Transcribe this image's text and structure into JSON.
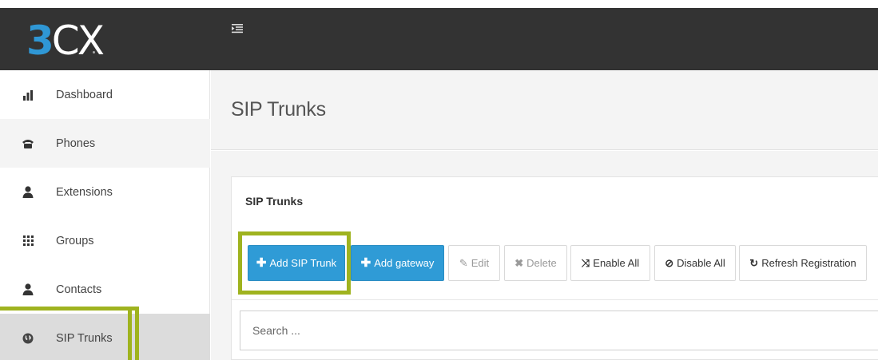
{
  "brand": {
    "logo_number": "3",
    "logo_letters": "CX",
    "accent_color": "#2f97d5"
  },
  "topbar": {
    "menu_toggle_icon": "menu-toggle-icon"
  },
  "sidebar": {
    "items": [
      {
        "label": "Dashboard",
        "icon": "bar-chart-icon"
      },
      {
        "label": "Phones",
        "icon": "phone-icon"
      },
      {
        "label": "Extensions",
        "icon": "user-icon"
      },
      {
        "label": "Groups",
        "icon": "grid-icon"
      },
      {
        "label": "Contacts",
        "icon": "user-icon"
      },
      {
        "label": "SIP Trunks",
        "icon": "globe-icon",
        "active": true
      }
    ]
  },
  "page": {
    "title": "SIP Trunks"
  },
  "panel": {
    "title": "SIP Trunks",
    "toolbar": {
      "add_sip_trunk": "Add SIP Trunk",
      "add_gateway": "Add gateway",
      "edit": "Edit",
      "delete": "Delete",
      "enable_all": "Enable All",
      "disable_all": "Disable All",
      "refresh_registration": "Refresh Registration"
    },
    "search": {
      "placeholder": "Search ..."
    }
  },
  "highlight_color": "#9fb31f"
}
